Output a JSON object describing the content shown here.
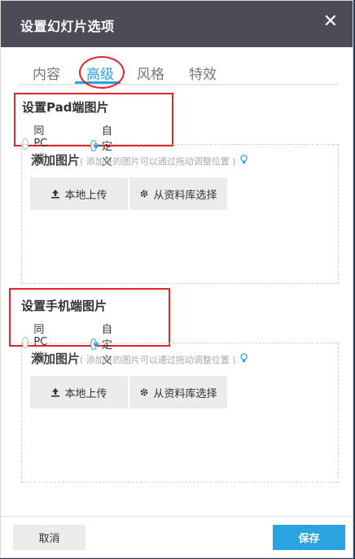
{
  "dialog": {
    "title": "设置幻灯片选项",
    "close_glyph": "✕"
  },
  "tabs": [
    {
      "label": "内容",
      "active": false
    },
    {
      "label": "高级",
      "active": true
    },
    {
      "label": "风格",
      "active": false
    },
    {
      "label": "特效",
      "active": false
    }
  ],
  "pad_section": {
    "title": "设置Pad端图片",
    "options": [
      {
        "label": "同PC端",
        "checked": false
      },
      {
        "label": "自定义",
        "checked": true
      }
    ],
    "add": {
      "title": "添加图片",
      "hint": "( 添加好的图片可以通过拖动调整位置 )",
      "bulb_icon": "lightbulb-icon",
      "upload_label": "本地上传",
      "library_label": "从资料库选择"
    }
  },
  "mobile_section": {
    "title": "设置手机端图片",
    "options": [
      {
        "label": "同PC端",
        "checked": false
      },
      {
        "label": "自定义",
        "checked": true
      }
    ],
    "add": {
      "title": "添加图片",
      "hint": "( 添加好的图片可以通过拖动调整位置 )",
      "bulb_icon": "lightbulb-icon",
      "upload_label": "本地上传",
      "library_label": "从资料库选择"
    }
  },
  "footer": {
    "cancel_label": "取消",
    "save_label": "保存"
  },
  "colors": {
    "accent": "#2aa3e0",
    "titlebar": "#4a4d55",
    "annotation": "#e0262a"
  }
}
